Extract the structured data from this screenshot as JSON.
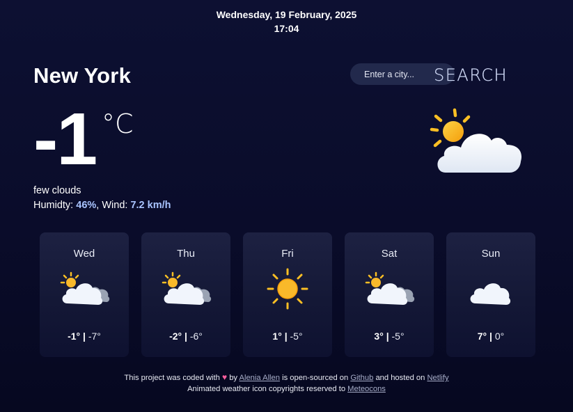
{
  "header": {
    "date": "Wednesday, 19 February, 2025",
    "time": "17:04"
  },
  "current": {
    "city": "New York",
    "temperature": "-1",
    "unit": "°C",
    "description": "few clouds",
    "humidity_label": "Humidty:",
    "humidity_value": "46%",
    "wind_label": "Wind:",
    "wind_value": "7.2 km/h",
    "icon": "partly-cloudy-day-icon"
  },
  "search": {
    "placeholder": "Enter a city...",
    "button_label": "SEARCH"
  },
  "forecast": [
    {
      "day": "Wed",
      "max": "-1°",
      "min": "-7°",
      "icon": "partly-cloudy-day-icon"
    },
    {
      "day": "Thu",
      "max": "-2°",
      "min": "-6°",
      "icon": "partly-cloudy-day-icon"
    },
    {
      "day": "Fri",
      "max": "1°",
      "min": "-5°",
      "icon": "clear-day-icon"
    },
    {
      "day": "Sat",
      "max": "3°",
      "min": "-5°",
      "icon": "partly-cloudy-day-icon"
    },
    {
      "day": "Sun",
      "max": "7°",
      "min": "0°",
      "icon": "cloudy-icon"
    }
  ],
  "footer": {
    "line1_prefix": "This project was coded with",
    "line1_by": "by",
    "author": "Alenia Allen",
    "open_sourced": "is open-sourced on",
    "github": "Github",
    "hosted": "and hosted on",
    "netlify": "Netlify",
    "line2_prefix": "Animated weather icon copyrights reserved to",
    "meteocons": "Meteocons"
  },
  "colors": {
    "background": "#0a0c2a",
    "card": "#1a1e3e",
    "accent": "#a9c4ff",
    "sun": "#f9b92a",
    "cloud": "#f1f5fc"
  }
}
